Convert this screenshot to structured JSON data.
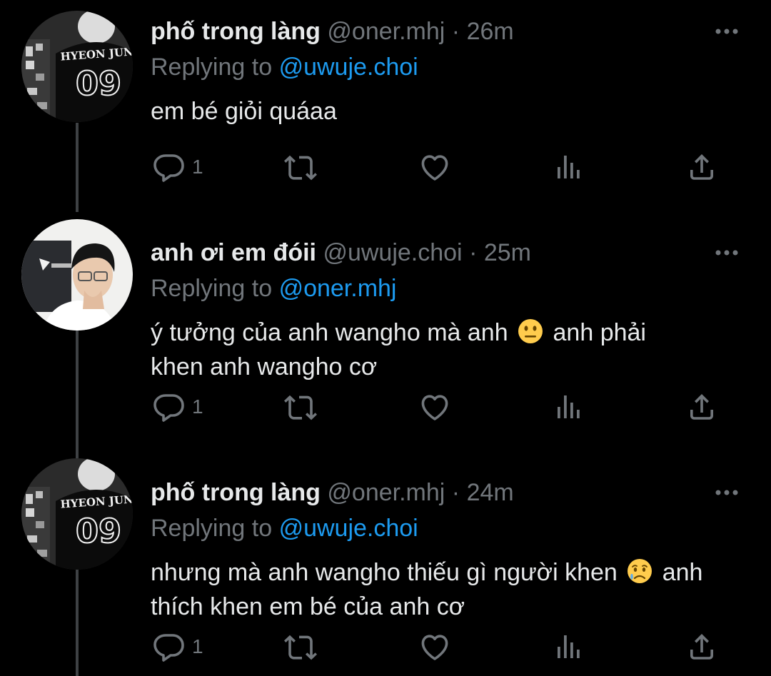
{
  "tweets": [
    {
      "display_name": "phố trong làng",
      "handle": "@oner.mhj",
      "separator": "·",
      "time": "26m",
      "replying_prefix": "Replying to",
      "replying_to": "@uwuje.choi",
      "text_before": "em bé giỏi quáaa",
      "emoji": "",
      "text_after": "",
      "reply_count": "1",
      "avatar_text_top": "HYEON JUN",
      "avatar_text_number": "09"
    },
    {
      "display_name": "anh ơi em đóii",
      "handle": "@uwuje.choi",
      "separator": "·",
      "time": "25m",
      "replying_prefix": "Replying to",
      "replying_to": "@oner.mhj",
      "text_before": "ý tưởng của anh wangho mà anh",
      "emoji": "neutral-face",
      "text_after": "anh phải khen anh wangho cơ",
      "reply_count": "1",
      "avatar_text_top": "",
      "avatar_text_number": ""
    },
    {
      "display_name": "phố trong làng",
      "handle": "@oner.mhj",
      "separator": "·",
      "time": "24m",
      "replying_prefix": "Replying to",
      "replying_to": "@uwuje.choi",
      "text_before": "nhưng mà anh wangho thiếu gì người khen",
      "emoji": "sad-relieved-face",
      "text_after": "anh thích khen em bé của anh cơ",
      "reply_count": "1",
      "avatar_text_top": "HYEON JUN",
      "avatar_text_number": "09"
    }
  ],
  "icons": {
    "reply": "reply-icon",
    "retweet": "retweet-icon",
    "like": "heart-icon",
    "views": "views-icon",
    "share": "share-icon",
    "more": "more-icon"
  },
  "colors": {
    "background": "#000000",
    "text": "#e7e9ea",
    "secondary": "#71767b",
    "link": "#1d9bf0",
    "thread_line": "#3e4144"
  }
}
